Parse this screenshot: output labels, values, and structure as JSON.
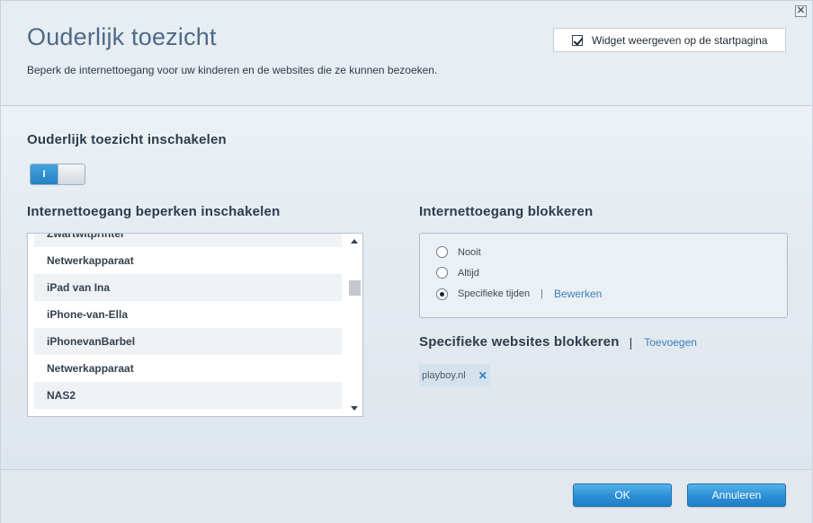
{
  "header": {
    "title": "Ouderlijk toezicht",
    "subtitle": "Beperk de internettoegang voor uw kinderen en de websites die ze kunnen bezoeken.",
    "widget_label": "Widget weergeven op de startpagina",
    "widget_checked": true,
    "close_symbol": "✕"
  },
  "parental": {
    "enable_heading": "Ouderlijk toezicht inschakelen",
    "toggle_label": "I",
    "toggle_on": true
  },
  "restrict": {
    "heading": "Internettoegang beperken inschakelen",
    "devices": [
      "Zwartwitprinter",
      "Netwerkapparaat",
      "iPad van Ina",
      "iPhone-van-Ella",
      "iPhonevanBarbel",
      "Netwerkapparaat",
      "NAS2"
    ]
  },
  "block": {
    "heading": "Internettoegang blokkeren",
    "options": [
      "Nooit",
      "Altijd",
      "Specifieke tijden"
    ],
    "selected": "Specifieke tijden",
    "separator": "|",
    "edit_link": "Bewerken"
  },
  "sites": {
    "heading": "Specifieke websites blokkeren",
    "separator": "|",
    "add_link": "Toevoegen",
    "blocked": [
      {
        "name": "playboy.nl",
        "remove_symbol": "✕"
      }
    ]
  },
  "footer": {
    "ok_label": "OK",
    "cancel_label": "Annuleren"
  },
  "colors": {
    "accent": "#2c8fd6",
    "link": "#3d7fb8",
    "title": "#4f6a86"
  }
}
